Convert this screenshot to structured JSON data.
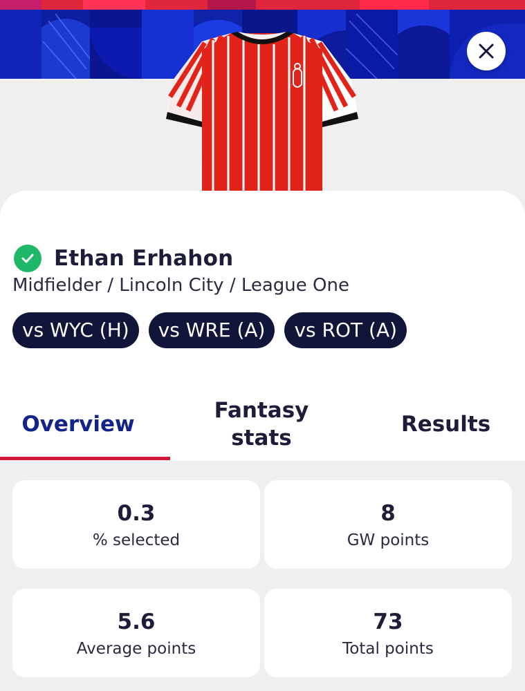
{
  "player": {
    "name": "Ethan Erhahon",
    "meta": "Midfielder / Lincoln City / League One",
    "status": "available"
  },
  "fixtures": [
    "vs WYC (H)",
    "vs WRE (A)",
    "vs ROT (A)"
  ],
  "tabs": [
    {
      "label": "Overview",
      "active": true
    },
    {
      "label": "Fantasy stats",
      "active": false
    },
    {
      "label": "Results",
      "active": false
    }
  ],
  "stats": [
    {
      "value": "0.3",
      "label": "% selected"
    },
    {
      "value": "8",
      "label": "GW points"
    },
    {
      "value": "5.6",
      "label": "Average points"
    },
    {
      "value": "73",
      "label": "Total points"
    }
  ],
  "colors": {
    "banner": "#0a1aa6",
    "accent_red": "#d11a3a",
    "navy": "#12153a",
    "check_green": "#1fb86a",
    "active_tab": "#12238a",
    "shirt_red": "#e2231a"
  },
  "icons": {
    "close": "close-icon",
    "status": "check-icon",
    "kit": "team-shirt"
  }
}
